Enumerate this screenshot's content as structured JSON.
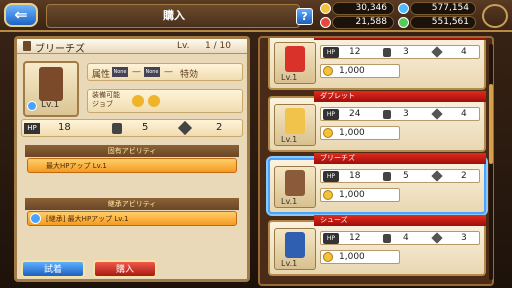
{
  "header": {
    "back_label": "⇐",
    "title": "購入",
    "help_label": "?"
  },
  "currencies": {
    "gold": "30,346",
    "crystal": "577,154",
    "red": "21,588",
    "green": "551,561"
  },
  "detail": {
    "name": "ブリーチズ",
    "lv_label": "Lv.",
    "lv_value": "1 / 10",
    "icon_lv": "Lv.1",
    "attr_label": "属性",
    "attr1": "None",
    "dash1": "—",
    "attr2": "None",
    "dash2": "—",
    "special_label": "特効",
    "equip_label": "装備可能\nジョブ",
    "hp_label": "HP",
    "hp": "18",
    "def": "5",
    "res": "2",
    "unique_title": "固有アビリティ",
    "unique_ability": "最大HPアップ Lv.1",
    "inherit_title": "継承アビリティ",
    "inherit_ability": "[継承] 最大HPアップ Lv.1"
  },
  "buttons": {
    "try_on": "試着",
    "buy": "購入"
  },
  "items": [
    {
      "name": "",
      "lv": "Lv.1",
      "hp": "12",
      "def": "3",
      "res": "4",
      "price": "1,000",
      "color": "#d8322a",
      "selected": false
    },
    {
      "name": "ダブレット",
      "lv": "Lv.1",
      "hp": "24",
      "def": "3",
      "res": "4",
      "price": "1,000",
      "color": "#f1c34a",
      "selected": false
    },
    {
      "name": "ブリーチズ",
      "lv": "Lv.1",
      "hp": "18",
      "def": "5",
      "res": "2",
      "price": "1,000",
      "color": "#8a5a3a",
      "selected": true
    },
    {
      "name": "シューズ",
      "lv": "Lv.1",
      "hp": "12",
      "def": "4",
      "res": "3",
      "price": "1,000",
      "color": "#2f5fb0",
      "selected": false
    }
  ]
}
